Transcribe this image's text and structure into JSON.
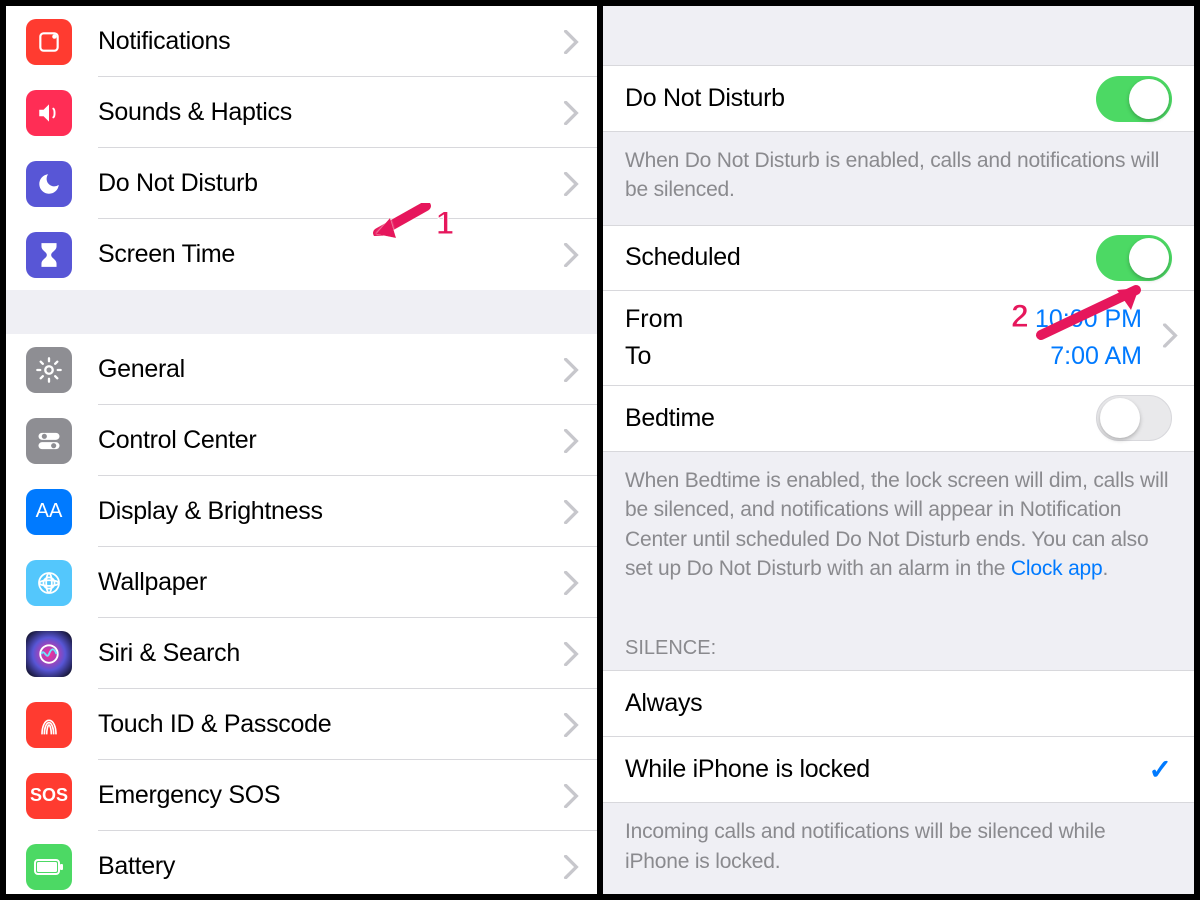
{
  "left": {
    "group1": [
      {
        "label": "Notifications",
        "icon": "notifications-icon"
      },
      {
        "label": "Sounds & Haptics",
        "icon": "sounds-icon"
      },
      {
        "label": "Do Not Disturb",
        "icon": "dnd-icon"
      },
      {
        "label": "Screen Time",
        "icon": "screentime-icon"
      }
    ],
    "group2": [
      {
        "label": "General",
        "icon": "general-icon"
      },
      {
        "label": "Control Center",
        "icon": "controlcenter-icon"
      },
      {
        "label": "Display & Brightness",
        "icon": "display-icon"
      },
      {
        "label": "Wallpaper",
        "icon": "wallpaper-icon"
      },
      {
        "label": "Siri & Search",
        "icon": "siri-icon"
      },
      {
        "label": "Touch ID & Passcode",
        "icon": "touchid-icon"
      },
      {
        "label": "Emergency SOS",
        "icon": "sos-icon"
      },
      {
        "label": "Battery",
        "icon": "battery-icon"
      }
    ]
  },
  "right": {
    "dnd": {
      "label": "Do Not Disturb",
      "on": true
    },
    "dnd_footer": "When Do Not Disturb is enabled, calls and notifications will be silenced.",
    "scheduled": {
      "label": "Scheduled",
      "on": true
    },
    "from_label": "From",
    "from_value": "10:00 PM",
    "to_label": "To",
    "to_value": "7:00 AM",
    "bedtime": {
      "label": "Bedtime",
      "on": false
    },
    "bedtime_footer_pre": "When Bedtime is enabled, the lock screen will dim, calls will be silenced, and notifications will appear in Notification Center until scheduled Do Not Disturb ends. You can also set up Do Not Disturb with an alarm in the ",
    "bedtime_footer_link": "Clock app",
    "bedtime_footer_post": ".",
    "silence_header": "SILENCE:",
    "silence_always": "Always",
    "silence_locked": "While iPhone is locked",
    "silence_footer": "Incoming calls and notifications will be silenced while iPhone is locked."
  },
  "annotations": {
    "one": "1",
    "two": "2"
  }
}
